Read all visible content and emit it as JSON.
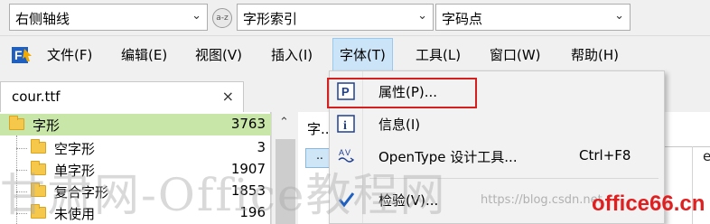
{
  "toolbar": {
    "combo1": "右侧轴线",
    "combo2": "字形索引",
    "combo3": "字码点",
    "az_icon_text": "a-z"
  },
  "menubar": {
    "items": [
      "文件(F)",
      "编辑(E)",
      "视图(V)",
      "插入(I)",
      "字体(T)",
      "工具(L)",
      "窗口(W)",
      "帮助(H)"
    ]
  },
  "tab": {
    "name": "cour.ttf",
    "close": "×"
  },
  "tree": {
    "root": {
      "label": "字形",
      "count": "3763"
    },
    "children": [
      {
        "label": "空字形",
        "count": "3"
      },
      {
        "label": "单字形",
        "count": "1907"
      },
      {
        "label": "复合字形",
        "count": "1853"
      },
      {
        "label": "未使用",
        "count": "196"
      }
    ]
  },
  "content": {
    "head": "字...",
    "cell": "..",
    "col_e": "e"
  },
  "dropdown": {
    "items": [
      {
        "icon": "properties-icon",
        "label": "属性(P)...",
        "shortcut": ""
      },
      {
        "icon": "info-icon",
        "label": "信息(I)",
        "shortcut": ""
      },
      {
        "icon": "opentype-tool-icon",
        "label": "OpenType 设计工具...",
        "shortcut": "Ctrl+F8"
      },
      {
        "icon": "check-icon",
        "label": "检验(V)...",
        "shortcut": ""
      }
    ]
  },
  "watermark": {
    "main": "甘肃网-Office教程网",
    "url": "https://blog.csdn.net",
    "office": "office66.cn"
  },
  "colors": {
    "highlight": "#d52020",
    "selection": "#c8e6a7",
    "menu_open": "#cce4f7"
  }
}
